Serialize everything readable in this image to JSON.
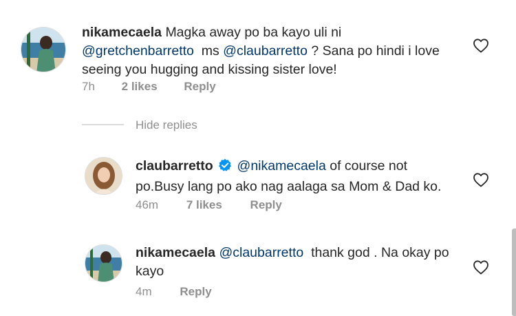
{
  "colors": {
    "mention": "#00376b",
    "meta": "#8e8e8e",
    "text": "#262626",
    "verified": "#0095f6"
  },
  "comments": [
    {
      "username": "nikamecaela",
      "parts": [
        {
          "text": "Magka away po ba kayo uli ni",
          "type": "text"
        },
        {
          "text": "@gretchenbarretto",
          "type": "mention"
        },
        {
          "text": "ms",
          "type": "text"
        },
        {
          "text": "@claubarretto",
          "type": "mention"
        },
        {
          "text": "? Sana po hindi i love",
          "type": "text"
        },
        {
          "text": "seeing you hugging and kissing sister love!",
          "type": "text"
        }
      ],
      "time": "7h",
      "likes": "2 likes",
      "reply": "Reply"
    }
  ],
  "hide_replies": "Hide replies",
  "replies": [
    {
      "username": "claubarretto",
      "verified": true,
      "parts": [
        {
          "text": "@nikamecaela",
          "type": "mention"
        },
        {
          "text": "of course not",
          "type": "text"
        },
        {
          "text": "po.Busy lang po ako nag aalaga sa Mom & Dad ko.",
          "type": "text"
        }
      ],
      "time": "46m",
      "likes": "7 likes",
      "reply": "Reply"
    },
    {
      "username": "nikamecaela",
      "parts": [
        {
          "text": "@claubarretto",
          "type": "mention"
        },
        {
          "text": "thank god . Na okay po",
          "type": "text"
        },
        {
          "text": "kayo",
          "type": "text"
        }
      ],
      "time": "4m",
      "reply": "Reply"
    }
  ]
}
